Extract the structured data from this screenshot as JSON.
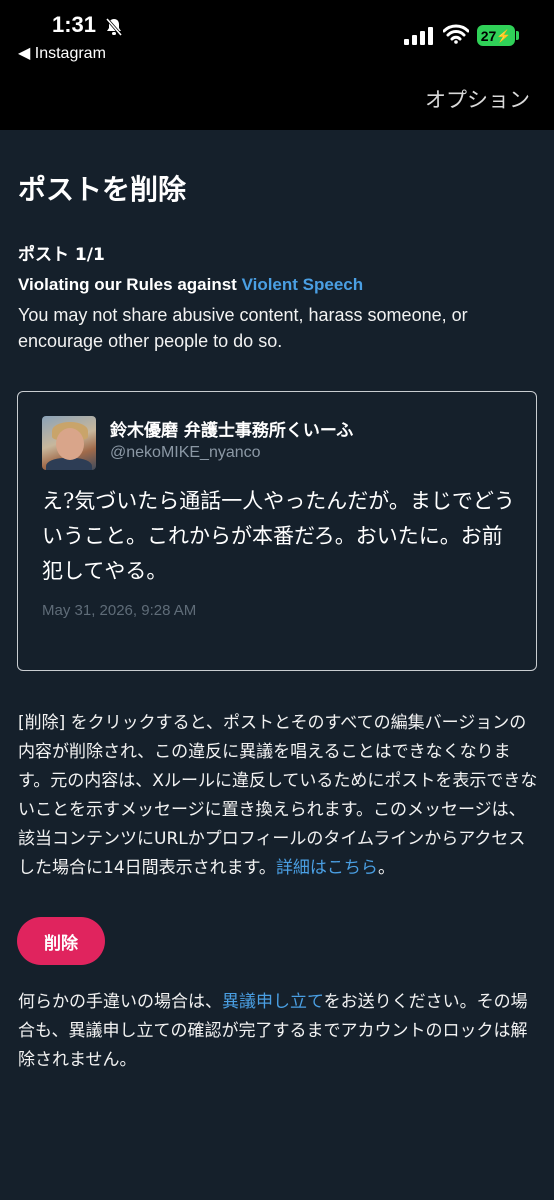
{
  "status_bar": {
    "time": "1:31",
    "back_app": "◀ Instagram",
    "battery": "27"
  },
  "header": {
    "options_label": "オプション"
  },
  "page": {
    "title": "ポストを削除",
    "post_count": "ポスト 1/1",
    "rule_prefix": "Violating our Rules against ",
    "rule_link": "Violent Speech",
    "rule_description": "You may not share abusive content, harass someone, or encourage other people to do so."
  },
  "tweet": {
    "name": "鈴木優磨 弁護士事務所くいーふ",
    "handle": "@nekoMIKE_nyanco",
    "text": "え?気づいたら通話一人やったんだが。まじでどういうこと。これからが本番だろ。おいたに。お前犯してやる。",
    "date": "May 31, 2026, 9:28 AM"
  },
  "explanation": {
    "text": "[削除] をクリックすると、ポストとそのすべての編集バージョンの内容が削除され、この違反に異議を唱えることはできなくなります。元の内容は、Xルールに違反しているためにポストを表示できないことを示すメッセージに置き換えられます。このメッセージは、該当コンテンツにURLかプロフィールのタイムラインからアクセスした場合に14日間表示されます。",
    "link": "詳細はこちら",
    "suffix": "。"
  },
  "delete_button_label": "削除",
  "appeal": {
    "prefix": "何らかの手違いの場合は、",
    "link": "異議申し立て",
    "suffix": "をお送りください。その場合も、異議申し立ての確認が完了するまでアカウントのロックは解除されません。"
  },
  "colors": {
    "background": "#15202b",
    "link": "#4a9fe3",
    "delete": "#e0245e",
    "battery": "#30d158"
  }
}
